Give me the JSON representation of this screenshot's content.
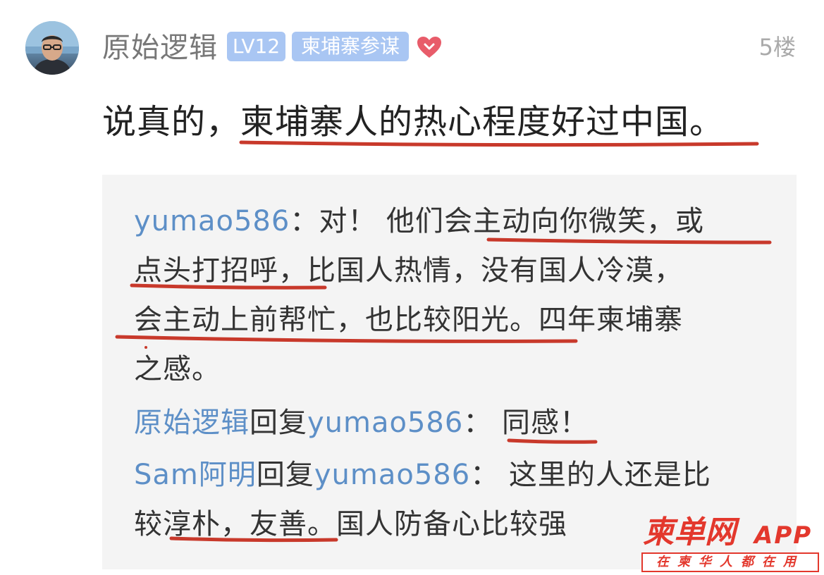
{
  "post": {
    "username": "原始逻辑",
    "level_badge": "LV12",
    "title_badge": "柬埔寨参谋",
    "floor": "5楼",
    "content": "说真的，柬埔寨人的热心程度好过中国。"
  },
  "replies": {
    "line1_user": "yumao586",
    "line1_text": "：对！ 他们会主动向你微笑，或",
    "line2_text": "点头打招呼，比国人热情，没有国人冷漠，",
    "line3_text": "会主动上前帮忙，也比较阳光。四年柬埔寨",
    "line4_text": "之感。",
    "reply1_from": "原始逻辑",
    "reply1_mid": "回复",
    "reply1_to": "yumao586",
    "reply1_text": "： 同感！",
    "reply2_from": "Sam阿明",
    "reply2_mid": "回复",
    "reply2_to": "yumao586",
    "reply2_text": "： 这里的人还是比",
    "reply2_text_cont": "较淳朴，友善。国人防备心比较强"
  },
  "watermark": {
    "logo": "柬单网",
    "app": "APP",
    "tagline": "在柬华人都在用"
  },
  "colors": {
    "link_blue": "#5d8fc7",
    "badge_bg": "#a9c6f3",
    "heart": "#e85c6a",
    "underline_red": "#c8392b",
    "brand_red": "#e3382d"
  },
  "icons": {
    "avatar": "user-avatar-photo",
    "heart": "heart-icon"
  }
}
